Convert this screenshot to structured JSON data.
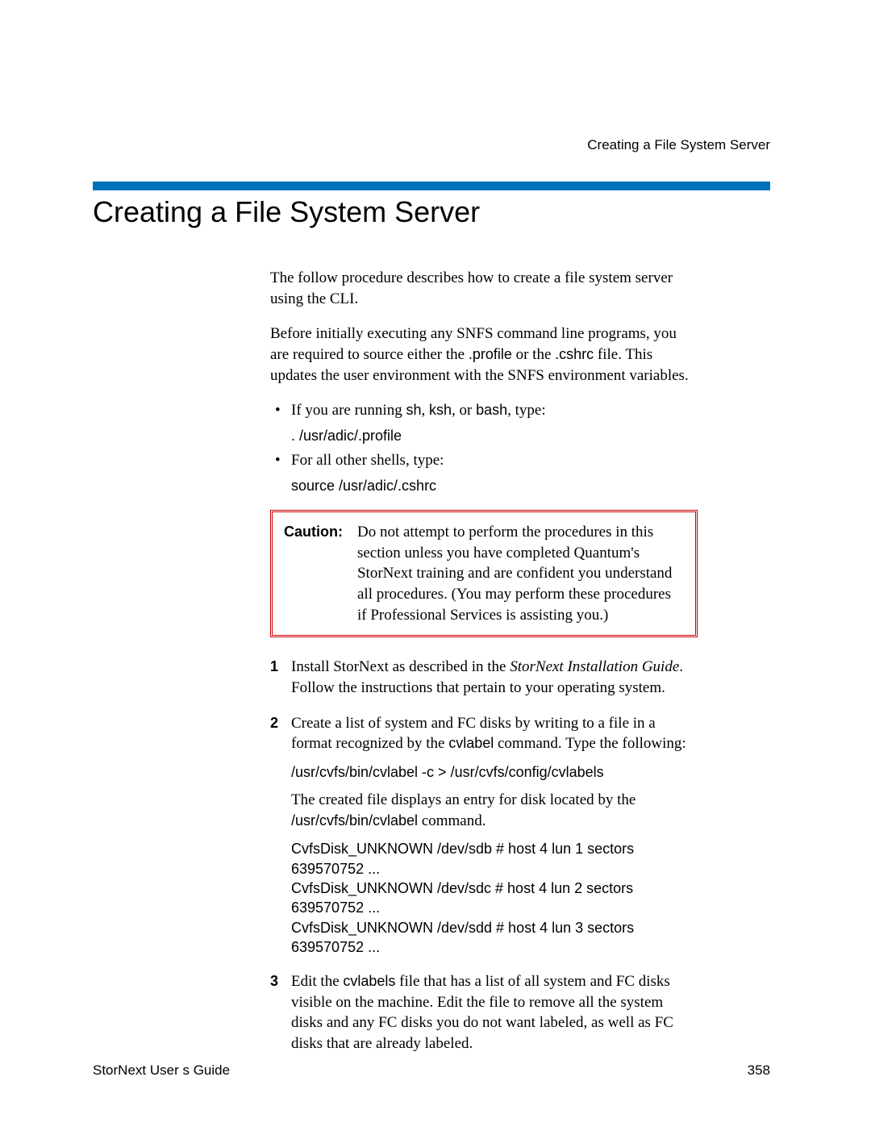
{
  "running_header": "Creating a File System Server",
  "heading": "Creating a File System Server",
  "intro1": "The follow procedure describes how to create a file system server using the CLI.",
  "intro2_parts": {
    "a": "Before initially executing any SNFS command line programs, you are required to source either the ",
    "profile": ".profile",
    "b": " or the ",
    "cshrc": ".cshrc",
    "c": " file. This updates the user environment with the SNFS environment variables."
  },
  "bullets": [
    {
      "lead_a": "If you are running ",
      "sh": "sh",
      "comma1": ", ",
      "ksh": "ksh",
      "comma2": ", or ",
      "bash": "bash",
      "tail": ", type:",
      "cmd": ". /usr/adic/.profile"
    },
    {
      "lead": "For all other shells, type:",
      "cmd": "source /usr/adic/.cshrc"
    }
  ],
  "caution_label": "Caution:",
  "caution_text": "Do not attempt to perform the procedures in this section unless you have completed Quantum's StorNext training and are confident you understand all procedures. (You may perform these procedures if Professional Services is assisting you.)",
  "steps": [
    {
      "pre": "Install StorNext as described in the ",
      "em": "StorNext Installation Guide",
      "post": ". Follow the instructions that pertain to your operating system."
    },
    {
      "pre": "Create a list of system and FC disks by writing to a file in a format recognized by the ",
      "code1": "cvlabel",
      "post": " command. Type the following:",
      "cmd": "/usr/cvfs/bin/cvlabel -c > /usr/cvfs/config/cvlabels",
      "result_pre": "The created file displays an entry for disk located by the ",
      "result_code": "/usr/cvfs/bin/cvlabel",
      "result_post": " command.",
      "output": [
        "CvfsDisk_UNKNOWN /dev/sdb # host 4 lun 1 sectors 639570752 ...",
        "CvfsDisk_UNKNOWN /dev/sdc # host 4 lun 2 sectors 639570752 ...",
        "CvfsDisk_UNKNOWN /dev/sdd # host 4 lun 3 sectors 639570752 ..."
      ]
    },
    {
      "pre": "Edit the ",
      "code1": "cvlabels",
      "post": " file that has a list of all system and FC disks visible on the machine. Edit the file to remove all the system disks and any FC disks you do not want labeled, as well as FC disks that are already labeled."
    }
  ],
  "footer_left": "StorNext User s Guide",
  "footer_right": "358"
}
